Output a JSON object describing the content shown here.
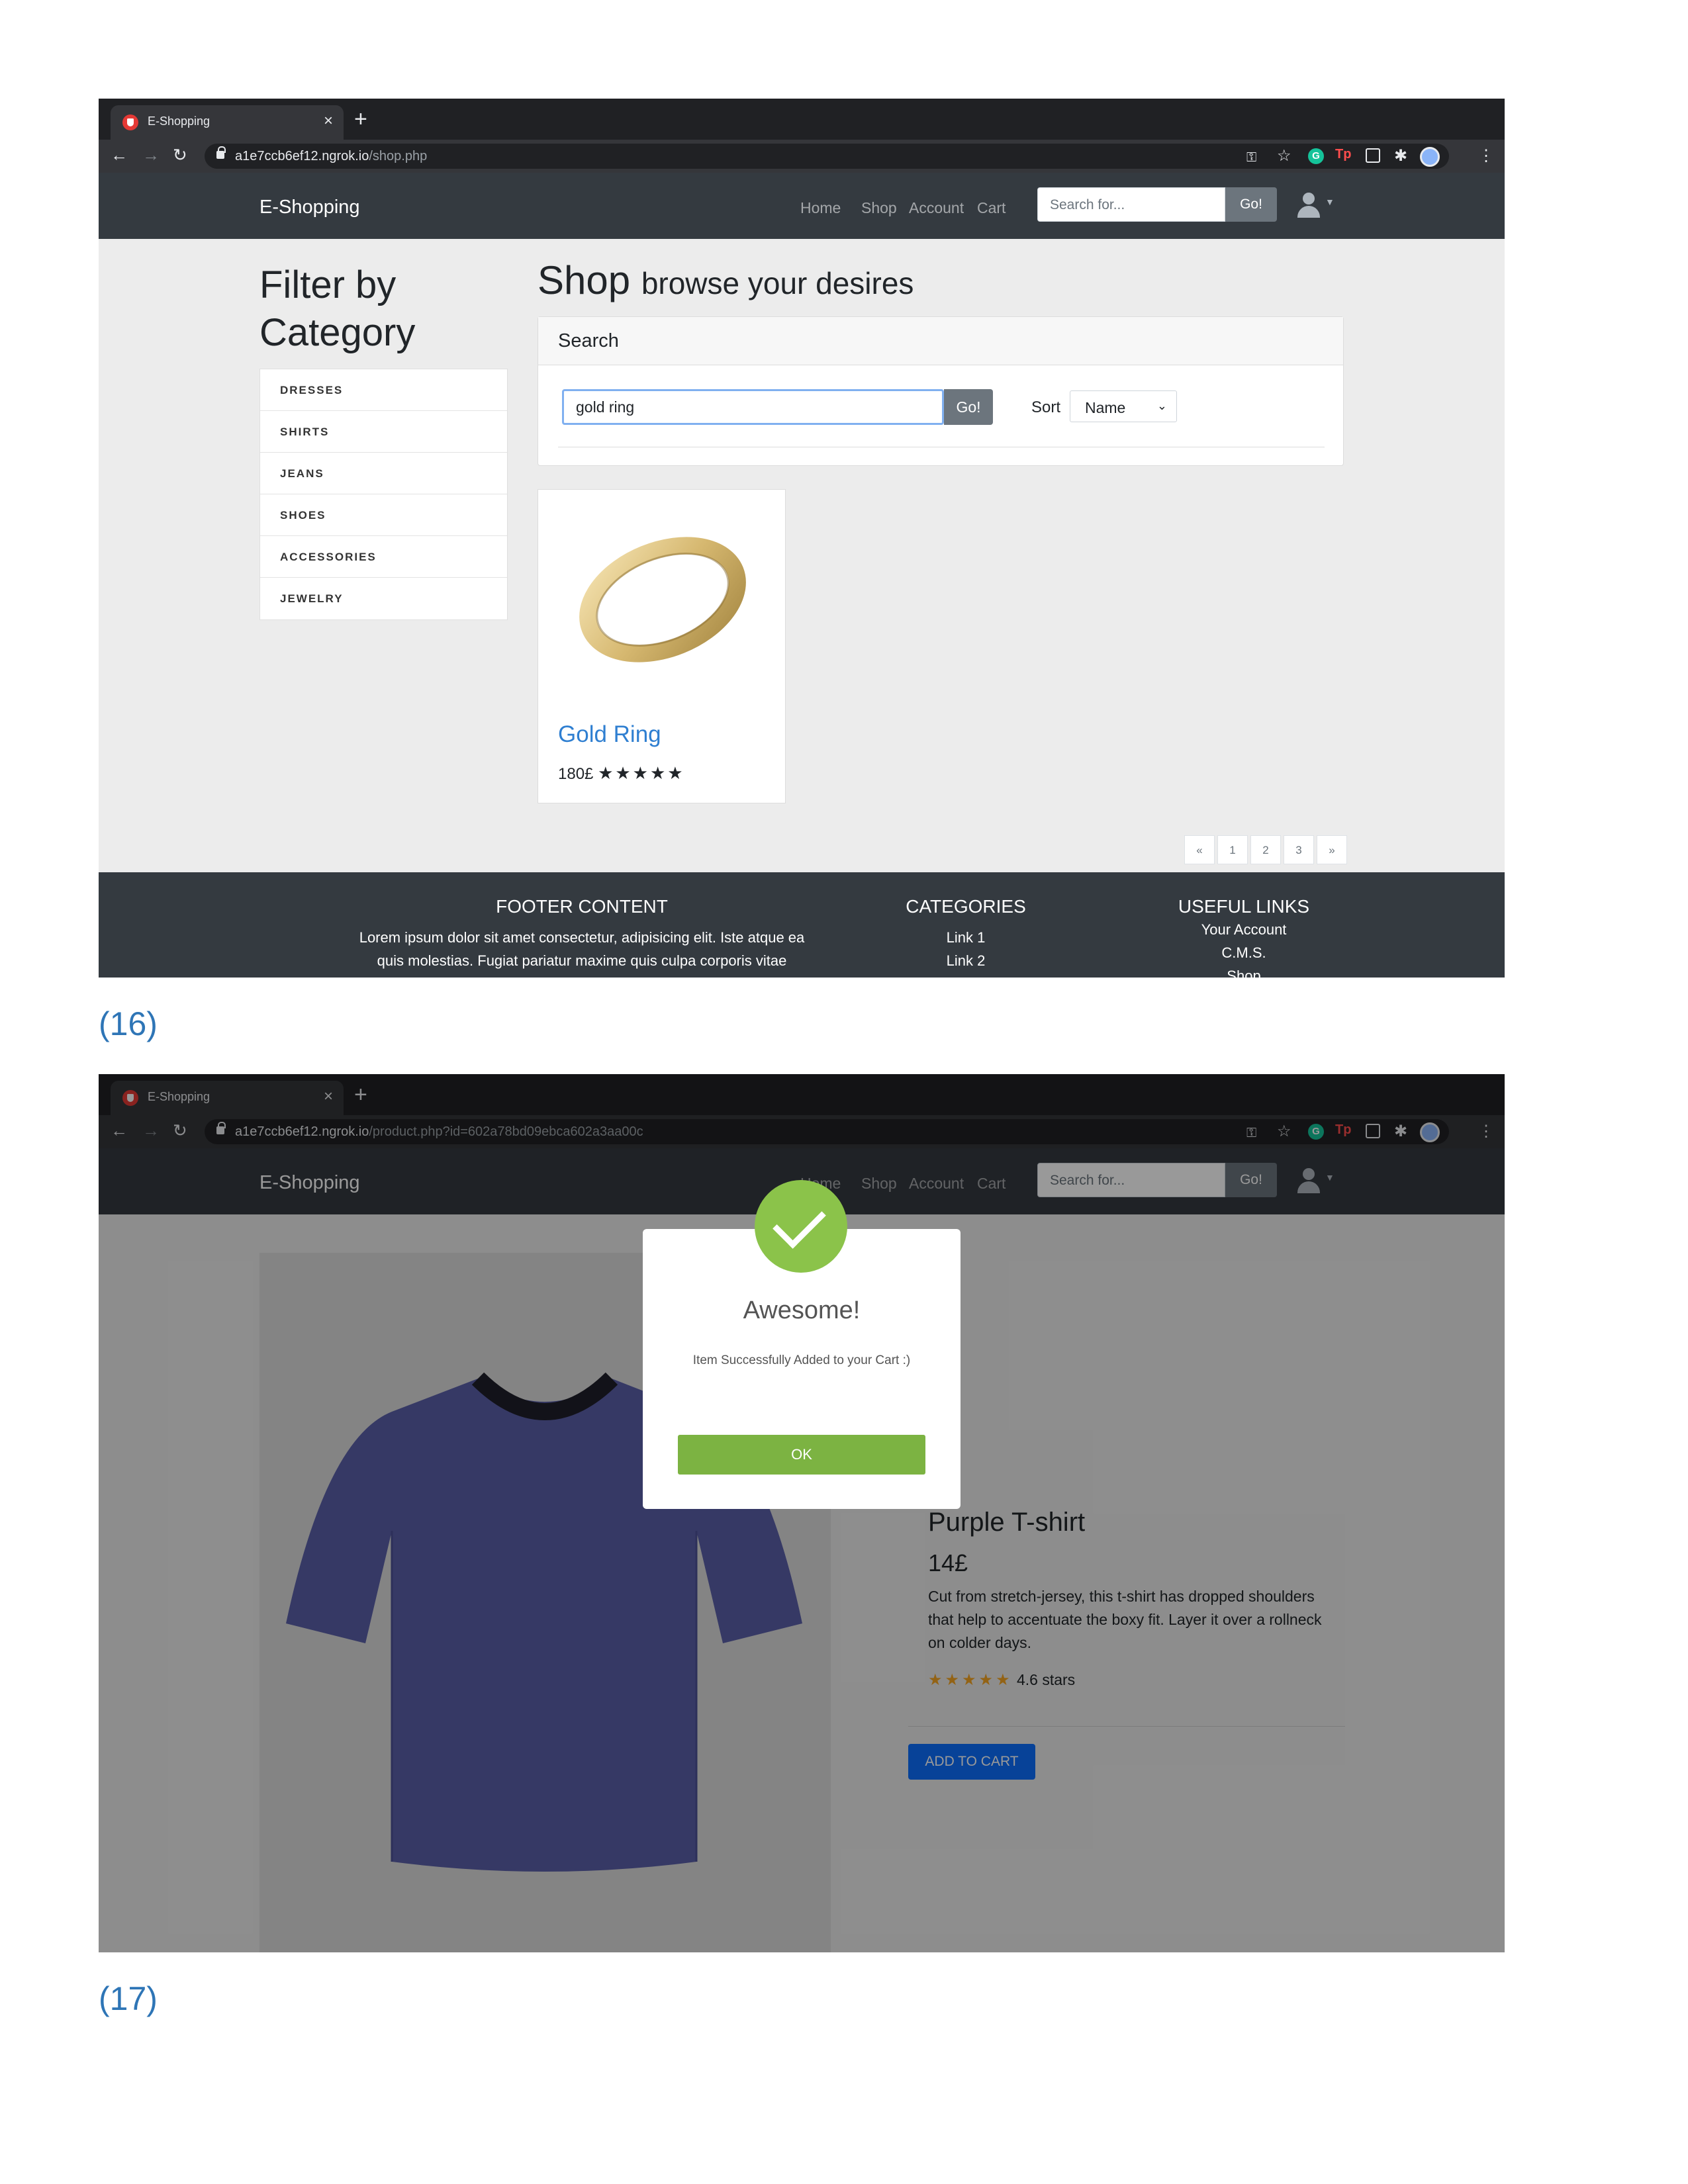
{
  "browser": {
    "tab_title": "E-Shopping",
    "tab_close": "×",
    "new_tab": "+",
    "back": "←",
    "forward": "→",
    "reload": "↻",
    "domain": "a1e7ccb6ef12.ngrok.io"
  },
  "site": {
    "brand": "E-Shopping",
    "nav": [
      "Home",
      "Shop",
      "Account",
      "Cart"
    ],
    "search_placeholder": "Search for...",
    "search_button": "Go!"
  },
  "screen1": {
    "caption": "(16)",
    "url_path": "/shop.php",
    "filter_title": "Filter by Category",
    "categories": [
      "DRESSES",
      "SHIRTS",
      "JEANS",
      "SHOES",
      "ACCESSORIES",
      "JEWELRY"
    ],
    "heading": "Shop",
    "heading_sub": "browse your desires",
    "search_card_title": "Search",
    "search_value": "gold ring",
    "search_button": "Go!",
    "sort_label": "Sort",
    "sort_value": "Name",
    "product": {
      "name": "Gold Ring",
      "price": "180£",
      "stars": "★★★★★"
    },
    "pagination": [
      "«",
      "1",
      "2",
      "3",
      "»"
    ],
    "footer": {
      "content_heading": "FOOTER CONTENT",
      "content_line1": "Lorem ipsum dolor sit amet consectetur, adipisicing elit. Iste atque ea",
      "content_line2": "quis molestias. Fugiat pariatur maxime quis culpa corporis vitae",
      "categories_heading": "CATEGORIES",
      "category_links": [
        "Link 1",
        "Link 2"
      ],
      "useful_heading": "USEFUL LINKS",
      "useful_links": [
        "Your Account",
        "C.M.S.",
        "Shop"
      ]
    }
  },
  "screen2": {
    "caption": "(17)",
    "url_path": "/product.php?id=602a78bd09ebca602a3aa00c",
    "product": {
      "title": "Purple T-shirt",
      "price": "14£",
      "description": "Cut from stretch-jersey, this t-shirt has dropped shoulders that help to accentuate the boxy fit. Layer it over a rollneck on colder days.",
      "stars": "★★★★★",
      "rating_text": "4.6 stars",
      "add_to_cart": "ADD TO CART"
    },
    "modal": {
      "title": "Awesome!",
      "message": "Item Successfully Added to your Cart :)",
      "ok_button": "OK"
    }
  },
  "colors": {
    "navbar": "#343a40",
    "link_blue": "#2f7fd1",
    "success_green": "#7cb342",
    "primary_blue": "#0d6efd",
    "caption_blue": "#2e75b6"
  },
  "icons": [
    "lock-icon",
    "key-icon",
    "star-bookmark-icon",
    "grammarly-icon",
    "tp-icon",
    "search-box-icon",
    "puzzle-icon",
    "profile-icon",
    "menu-dots-icon",
    "user-icon",
    "check-icon"
  ]
}
